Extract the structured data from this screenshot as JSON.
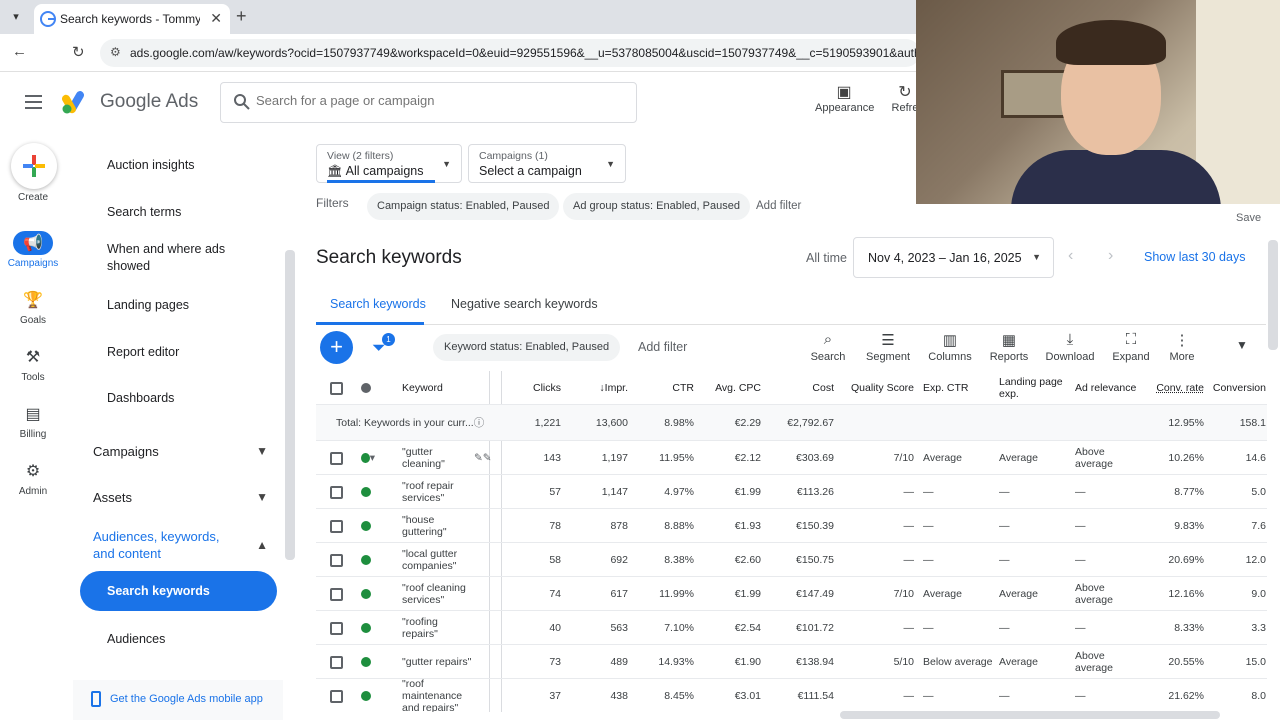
{
  "browser": {
    "tab_title": "Search keywords - Tommy Goo",
    "url": "ads.google.com/aw/keywords?ocid=1507937749&workspaceId=0&euid=929551596&__u=5378085004&uscid=1507937749&__c=5190593901&authuse"
  },
  "header": {
    "product": "Google Ads",
    "search_placeholder": "Search for a page or campaign",
    "appearance_label": "Appearance",
    "refresh_label": "Refre"
  },
  "rail": {
    "create": "Create",
    "items": [
      {
        "label": "Campaigns",
        "icon": "megaphone-icon"
      },
      {
        "label": "Goals",
        "icon": "trophy-icon"
      },
      {
        "label": "Tools",
        "icon": "tools-icon"
      },
      {
        "label": "Billing",
        "icon": "card-icon"
      },
      {
        "label": "Admin",
        "icon": "gear-icon"
      }
    ]
  },
  "sidenav": {
    "subitems": [
      "Auction insights",
      "Search terms",
      "When and where ads showed",
      "Landing pages",
      "Report editor",
      "Dashboards"
    ],
    "sections": [
      "Campaigns",
      "Assets",
      "Audiences, keywords, and content"
    ],
    "active": "Search keywords",
    "after_active": "Audiences",
    "mobile_app": "Get the Google Ads mobile app"
  },
  "main": {
    "view_label": "View (2 filters)",
    "view_value": "All campaigns",
    "campaigns_label": "Campaigns (1)",
    "campaigns_value": "Select a campaign",
    "filters_label": "Filters",
    "chips": [
      "Campaign status: Enabled, Paused",
      "Ad group status: Enabled, Paused"
    ],
    "add_filter": "Add filter",
    "save": "Save",
    "title": "Search keywords",
    "all_time": "All time",
    "date_range": "Nov 4, 2023 – Jan 16, 2025",
    "show_last": "Show last 30 days",
    "tab_search": "Search keywords",
    "tab_negative": "Negative search keywords",
    "filter_badge": "1",
    "keyword_status_chip": "Keyword status: Enabled, Paused",
    "add_filter2": "Add filter",
    "tools": {
      "search": "Search",
      "segment": "Segment",
      "columns": "Columns",
      "reports": "Reports",
      "download": "Download",
      "expand": "Expand",
      "more": "More"
    }
  },
  "table": {
    "headers": {
      "keyword": "Keyword",
      "clicks": "Clicks",
      "impr": "Impr.",
      "ctr": "CTR",
      "avg_cpc": "Avg. CPC",
      "cost": "Cost",
      "quality_score": "Quality Score",
      "exp_ctr": "Exp. CTR",
      "landing": "Landing page exp.",
      "ad_relevance": "Ad relevance",
      "conv_rate": "Conv. rate",
      "conversions": "Conversion"
    },
    "total": {
      "label": "Total: Keywords in your curr...",
      "clicks": "1,221",
      "impr": "13,600",
      "ctr": "8.98%",
      "avg_cpc": "€2.29",
      "cost": "€2,792.67",
      "conv_rate": "12.95%",
      "conversions": "158.1"
    },
    "rows": [
      {
        "keyword": "\"gutter cleaning\"",
        "clicks": "143",
        "impr": "1,197",
        "ctr": "11.95%",
        "avg_cpc": "€2.12",
        "cost": "€303.69",
        "qs": "7/10",
        "exp_ctr": "Average",
        "landing": "Average",
        "relevance": "Above average",
        "conv_rate": "10.26%",
        "conversions": "14.6"
      },
      {
        "keyword": "\"roof repair services\"",
        "clicks": "57",
        "impr": "1,147",
        "ctr": "4.97%",
        "avg_cpc": "€1.99",
        "cost": "€113.26",
        "qs": "—",
        "exp_ctr": "—",
        "landing": "—",
        "relevance": "—",
        "conv_rate": "8.77%",
        "conversions": "5.0"
      },
      {
        "keyword": "\"house guttering\"",
        "clicks": "78",
        "impr": "878",
        "ctr": "8.88%",
        "avg_cpc": "€1.93",
        "cost": "€150.39",
        "qs": "—",
        "exp_ctr": "—",
        "landing": "—",
        "relevance": "—",
        "conv_rate": "9.83%",
        "conversions": "7.6"
      },
      {
        "keyword": "\"local gutter companies\"",
        "clicks": "58",
        "impr": "692",
        "ctr": "8.38%",
        "avg_cpc": "€2.60",
        "cost": "€150.75",
        "qs": "—",
        "exp_ctr": "—",
        "landing": "—",
        "relevance": "—",
        "conv_rate": "20.69%",
        "conversions": "12.0"
      },
      {
        "keyword": "\"roof cleaning services\"",
        "clicks": "74",
        "impr": "617",
        "ctr": "11.99%",
        "avg_cpc": "€1.99",
        "cost": "€147.49",
        "qs": "7/10",
        "exp_ctr": "Average",
        "landing": "Average",
        "relevance": "Above average",
        "conv_rate": "12.16%",
        "conversions": "9.0"
      },
      {
        "keyword": "\"roofing repairs\"",
        "clicks": "40",
        "impr": "563",
        "ctr": "7.10%",
        "avg_cpc": "€2.54",
        "cost": "€101.72",
        "qs": "—",
        "exp_ctr": "—",
        "landing": "—",
        "relevance": "—",
        "conv_rate": "8.33%",
        "conversions": "3.3"
      },
      {
        "keyword": "\"gutter repairs\"",
        "clicks": "73",
        "impr": "489",
        "ctr": "14.93%",
        "avg_cpc": "€1.90",
        "cost": "€138.94",
        "qs": "5/10",
        "exp_ctr": "Below average",
        "landing": "Average",
        "relevance": "Above average",
        "conv_rate": "20.55%",
        "conversions": "15.0"
      },
      {
        "keyword": "\"roof maintenance and repairs\"",
        "clicks": "37",
        "impr": "438",
        "ctr": "8.45%",
        "avg_cpc": "€3.01",
        "cost": "€111.54",
        "qs": "—",
        "exp_ctr": "—",
        "landing": "—",
        "relevance": "—",
        "conv_rate": "21.62%",
        "conversions": "8.0"
      }
    ]
  },
  "colors": {
    "accent": "#1a73e8",
    "enabled": "#1e8e3e"
  }
}
